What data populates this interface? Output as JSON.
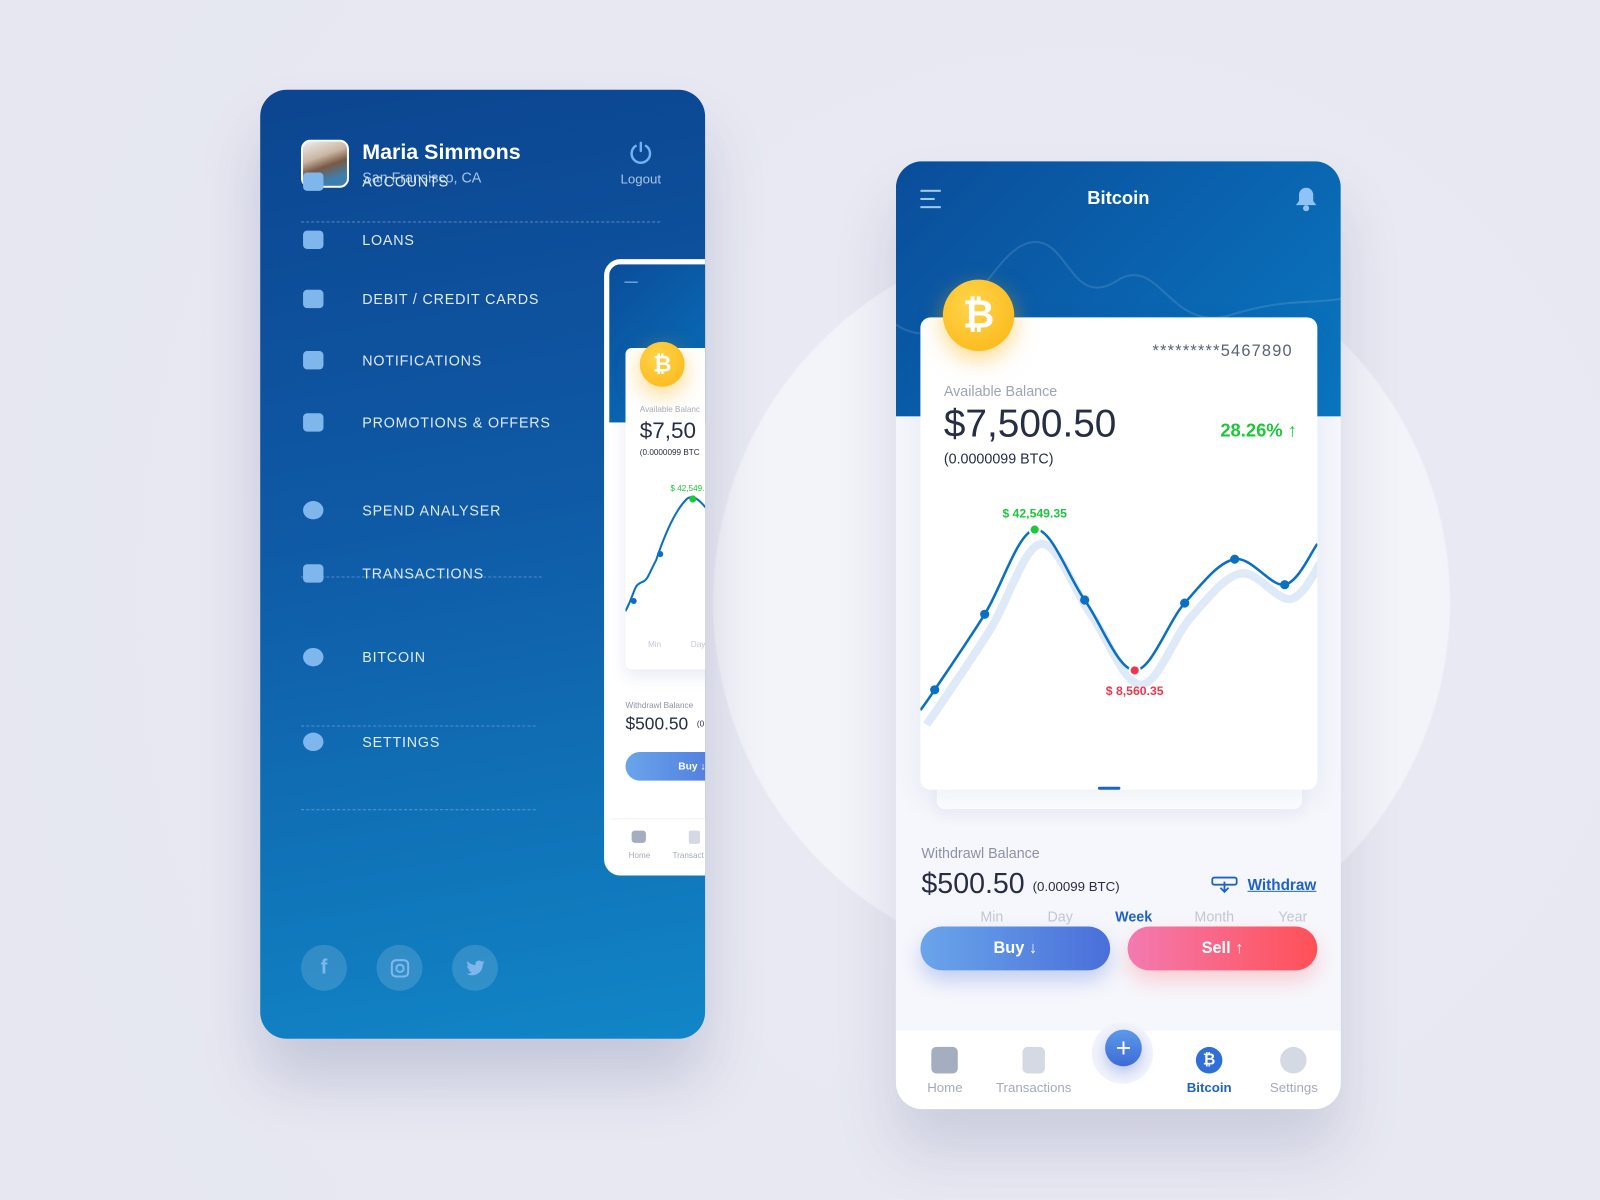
{
  "profile": {
    "name": "Maria Simmons",
    "location": "San Fransisco, CA",
    "logout_label": "Logout"
  },
  "menu": [
    {
      "label": "ACCOUNTS",
      "icon": "bank-icon"
    },
    {
      "label": "LOANS",
      "icon": "cash-icon"
    },
    {
      "label": "DEBIT / CREDIT CARDS",
      "icon": "card-icon"
    },
    {
      "label": "NOTIFICATIONS",
      "icon": "bell-icon"
    },
    {
      "label": "PROMOTIONS & OFFERS",
      "icon": "tag-icon"
    },
    {
      "label": "SPEND ANALYSER",
      "icon": "pie-chart-icon"
    },
    {
      "label": "TRANSACTIONS",
      "icon": "document-icon"
    },
    {
      "label": "BITCOIN",
      "icon": "bitcoin-icon"
    },
    {
      "label": "SETTINGS",
      "icon": "gear-icon"
    }
  ],
  "social": [
    "facebook-icon",
    "instagram-icon",
    "twitter-icon"
  ],
  "mini": {
    "available_label": "Available Balanc",
    "balance": "$7,50",
    "btc": "(0.0000099 BTC",
    "peak": "$ 42,549.",
    "tab_min": "Min",
    "tab_day": "Day",
    "withdraw_label": "Withdrawl Balance",
    "withdraw_value": "$500.50",
    "withdraw_btc": "(0",
    "buy": "Buy ↓",
    "nav_home": "Home",
    "nav_trans": "Transact"
  },
  "app": {
    "title": "Bitcoin",
    "account_number": "*********5467890",
    "available_label": "Available Balance",
    "balance": "$7,500.50",
    "balance_btc": "(0.0000099 BTC)",
    "change": "28.26% ↑",
    "withdraw_label": "Withdrawl Balance",
    "withdraw_value": "$500.50",
    "withdraw_btc": "(0.00099 BTC)",
    "withdraw_link": "Withdraw",
    "buy": "Buy ↓",
    "sell": "Sell ↑",
    "tabs": [
      "Min",
      "Day",
      "Week",
      "Month",
      "Year"
    ],
    "active_tab": "Week",
    "nav": [
      {
        "label": "Home"
      },
      {
        "label": "Transactions"
      },
      {
        "label": "Bitcoin",
        "active": true
      },
      {
        "label": "Settings"
      }
    ]
  },
  "colors": {
    "primary": "#0b5aa8",
    "accent_blue": "#1d62c8",
    "up_green": "#1ec63a",
    "down_red": "#f0364a",
    "coin": "#fbb414"
  },
  "chart_data": {
    "type": "line",
    "values": [
      3880,
      22105,
      42549.35,
      25553,
      8560.35,
      24814,
      35405,
      29248
    ],
    "high_label": "$ 42,549.35",
    "low_label": "$ 8,560.35",
    "high_index": 2,
    "low_index": 4
  }
}
